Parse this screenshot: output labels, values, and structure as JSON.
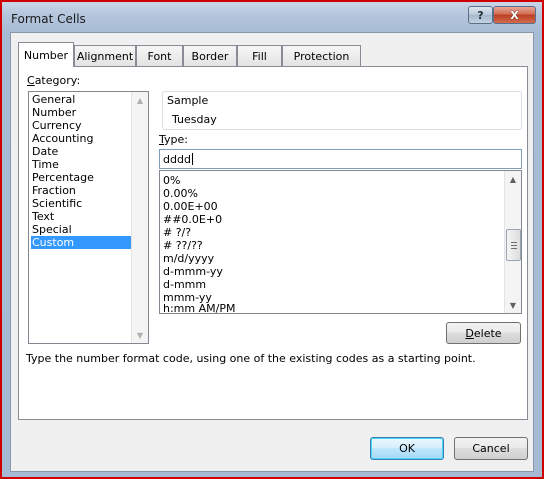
{
  "window": {
    "title": "Format Cells",
    "help_glyph": "?",
    "close_glyph": "X"
  },
  "tabs": [
    "Number",
    "Alignment",
    "Font",
    "Border",
    "Fill",
    "Protection"
  ],
  "active_tab": "Number",
  "category": {
    "label": "Category:",
    "items": [
      "General",
      "Number",
      "Currency",
      "Accounting",
      "Date",
      "Time",
      "Percentage",
      "Fraction",
      "Scientific",
      "Text",
      "Special",
      "Custom"
    ],
    "selected": "Custom"
  },
  "sample": {
    "label": "Sample",
    "value": "Tuesday"
  },
  "type": {
    "label": "Type:",
    "value": "dddd"
  },
  "formats": [
    "0%",
    "0.00%",
    "0.00E+00",
    "##0.0E+0",
    "# ?/?",
    "# ??/??",
    "m/d/yyyy",
    "d-mmm-yy",
    "d-mmm",
    "mmm-yy",
    "h:mm AM/PM"
  ],
  "buttons": {
    "delete": "Delete",
    "ok": "OK",
    "cancel": "Cancel"
  },
  "description": "Type the number format code, using one of the existing codes as a starting point."
}
